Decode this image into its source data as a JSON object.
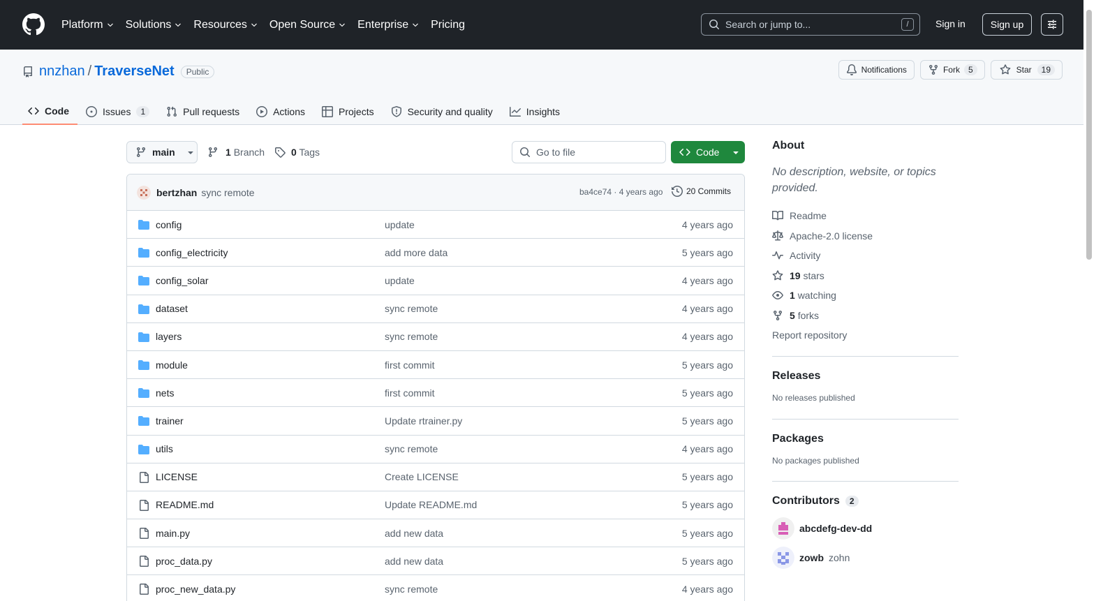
{
  "header": {
    "nav": [
      {
        "label": "Platform",
        "dropdown": true
      },
      {
        "label": "Solutions",
        "dropdown": true
      },
      {
        "label": "Resources",
        "dropdown": true
      },
      {
        "label": "Open Source",
        "dropdown": true
      },
      {
        "label": "Enterprise",
        "dropdown": true
      },
      {
        "label": "Pricing",
        "dropdown": false
      }
    ],
    "search_placeholder": "Search or jump to...",
    "search_key": "/",
    "signin_label": "Sign in",
    "signup_label": "Sign up"
  },
  "repo": {
    "owner": "nnzhan",
    "separator": "/",
    "name": "TraverseNet",
    "visibility": "Public",
    "notifications_label": "Notifications",
    "fork_label": "Fork",
    "fork_count": "5",
    "star_label": "Star",
    "star_count": "19"
  },
  "tabs": [
    {
      "label": "Code",
      "icon": "code-icon",
      "active": true,
      "count": ""
    },
    {
      "label": "Issues",
      "icon": "issue-icon",
      "active": false,
      "count": "1"
    },
    {
      "label": "Pull requests",
      "icon": "pull-request-icon",
      "active": false,
      "count": ""
    },
    {
      "label": "Actions",
      "icon": "play-icon",
      "active": false,
      "count": ""
    },
    {
      "label": "Projects",
      "icon": "table-icon",
      "active": false,
      "count": ""
    },
    {
      "label": "Security and quality",
      "icon": "shield-icon",
      "active": false,
      "count": ""
    },
    {
      "label": "Insights",
      "icon": "graph-icon",
      "active": false,
      "count": ""
    }
  ],
  "toolbar": {
    "branch": "main",
    "branch_count": "1",
    "branch_label": "Branch",
    "tag_count": "0",
    "tag_label": "Tags",
    "goto_placeholder": "Go to file",
    "code_label": "Code"
  },
  "commit": {
    "author": "bertzhan",
    "message": "sync remote",
    "hash_time": "ba4ce74 · 4 years ago",
    "commits_label": "20 Commits"
  },
  "files": [
    {
      "name": "config",
      "type": "folder",
      "message": "update",
      "age": "4 years ago"
    },
    {
      "name": "config_electricity",
      "type": "folder",
      "message": "add more data",
      "age": "5 years ago"
    },
    {
      "name": "config_solar",
      "type": "folder",
      "message": "update",
      "age": "4 years ago"
    },
    {
      "name": "dataset",
      "type": "folder",
      "message": "sync remote",
      "age": "4 years ago"
    },
    {
      "name": "layers",
      "type": "folder",
      "message": "sync remote",
      "age": "4 years ago"
    },
    {
      "name": "module",
      "type": "folder",
      "message": "first commit",
      "age": "5 years ago"
    },
    {
      "name": "nets",
      "type": "folder",
      "message": "first commit",
      "age": "5 years ago"
    },
    {
      "name": "trainer",
      "type": "folder",
      "message": "Update rtrainer.py",
      "age": "5 years ago"
    },
    {
      "name": "utils",
      "type": "folder",
      "message": "sync remote",
      "age": "4 years ago"
    },
    {
      "name": "LICENSE",
      "type": "file",
      "message": "Create LICENSE",
      "age": "5 years ago"
    },
    {
      "name": "README.md",
      "type": "file",
      "message": "Update README.md",
      "age": "5 years ago"
    },
    {
      "name": "main.py",
      "type": "file",
      "message": "add new data",
      "age": "5 years ago"
    },
    {
      "name": "proc_data.py",
      "type": "file",
      "message": "add new data",
      "age": "5 years ago"
    },
    {
      "name": "proc_new_data.py",
      "type": "file",
      "message": "sync remote",
      "age": "4 years ago"
    }
  ],
  "sidebar": {
    "about_title": "About",
    "about_desc": "No description, website, or topics provided.",
    "links": [
      {
        "icon": "book-icon",
        "strong": "",
        "text": "Readme"
      },
      {
        "icon": "law-icon",
        "strong": "",
        "text": "Apache-2.0 license"
      },
      {
        "icon": "pulse-icon",
        "strong": "",
        "text": "Activity"
      },
      {
        "icon": "star-icon",
        "strong": "19",
        "text": "stars"
      },
      {
        "icon": "eye-icon",
        "strong": "1",
        "text": "watching"
      },
      {
        "icon": "fork-icon",
        "strong": "5",
        "text": "forks"
      }
    ],
    "report_label": "Report repository",
    "releases_title": "Releases",
    "releases_note": "No releases published",
    "packages_title": "Packages",
    "packages_note": "No packages published",
    "contributors_title": "Contributors",
    "contributors_count": "2",
    "contributors": [
      {
        "login": "abcdefg-dev-dd",
        "name": ""
      },
      {
        "login": "zowb",
        "name": "zohn"
      }
    ]
  },
  "colors": {
    "header_bg": "#1f2328",
    "link": "#0969da",
    "code_button": "#1f883d",
    "active_tab_underline": "#fd8c73",
    "folder": "#54aeff"
  }
}
